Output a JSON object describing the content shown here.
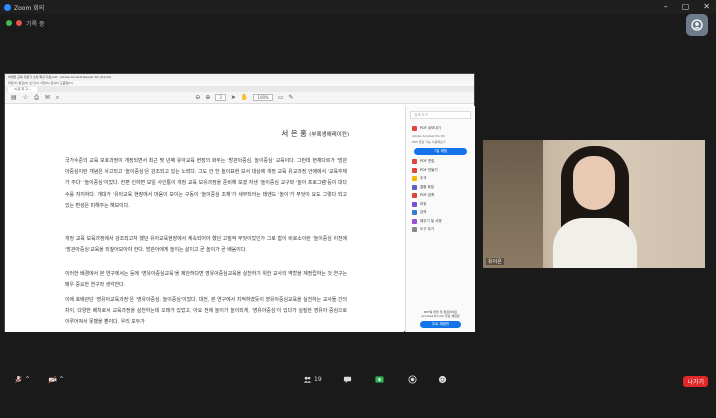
{
  "app": {
    "title": "Zoom 회의"
  },
  "window_controls": [
    "–",
    "▢",
    "✕"
  ],
  "info_bar": {
    "label": "기록 중"
  },
  "share": {
    "app_title": "비대면 교육 전문가 초빙 특강 자료.pdf - Adobe Acrobat Reader DC (64-bit)",
    "menu": "파일(F) 편집(E) 보기(V) 서명(S) 창(W) 도움말(H)",
    "tab": "서 은 희 구…",
    "toolbar": {
      "zoom": "100%",
      "page": "3"
    },
    "doc": {
      "heading_name": "서 은 홍",
      "heading_role": "(부록생애레이컨)",
      "paragraphs": [
        "국가수준의 교육 모호과정이 개정되면서 최근 몇 년째 유아교육 현장의 화두는 '방관아중심, 놀이중심' 교육이다. 그런데 현재다르가 '방관아중심이란 개념은 사고되고 '놀이중심'은 강조되고 있는 노력다. 그도 안 한 놀이표현 보서 대상에 개정 교육 유교과정 안에에서 '교육주체가 주다' '놀이중심'이었다. 한편 인하면 보일 사인통이 개정 교육 보유과정을 준비해 보겠 자생 '놀이중심 교구와 '놀이 프로그램'등이 대다수를 자지하다. 개대가 '유아교육 현장에서 마음이 보이는 구동이 '놀이중심 조체'가 세부되어는 태엔도 '놀이'가 무엇이 요도 그렇다 되고 있는 편성은 피해주는 해보이다.",
        "개정 교육 보육과정에서 강조되고자 했던 유아교육현장에서 계속되어야 했던 고질적 무엇이었인가 그로 함이 비로소이란 '놀이중심 이전에 '방관아중심'교육을 되짚어보아야 한다. 방관아에게 놀이는 삶이고 곧 놀이가 곧 배움이다.",
        "이러한 배경에서 본 연구에서는 등에 '영유아중심교육'을 제안하다면 영유아중심교육을 실천하기 위한 교사의 역할을 재정립하는 것 연구는 매우 중요한 연구라 생각한다.",
        "이에 호배관단 '영유아교육과정'은 '영유아중심, 놀이중심'이었다. 대전, 본 연구에서 지적하였듯이 영유아중심교육을 실천하는 교사들 간의 차이, 다양한 배치로서 교육과정을 실천하는데 오래가 있었고, 아요 전에 놀이가 놀이되게, '영유아중심'이 있다가 실질한 영유아 중심으로 이루어져서 못했을 뿐이다. 우리 모두가"
      ]
    },
    "right_panel": {
      "search": "검색 도구",
      "items": [
        "PDF 내보내기",
        "Adobe Acrobat Pro DC",
        "PDF 편집",
        "PDF 만들기",
        "주석",
        "결합 파일",
        "PDF 압축",
        "보호",
        "입력",
        "채우기 및 서명",
        "도구 추가"
      ],
      "promo": "Adobe Acrobat Pro DC",
      "promo_sub": "PDF 편집 기능 사용해보기",
      "cta": "7일 체험",
      "footer": "PDF를 변환 및 편집하세요\nAcrobat Pro DC 무료 체험판",
      "footer_btn": "무료 체험판"
    }
  },
  "video": {
    "name": "유이은"
  },
  "toolbar": {
    "items": [
      {
        "label": "^",
        "icon": "mic-icon"
      },
      {
        "label": "^",
        "icon": "video-icon"
      },
      {
        "label": "19",
        "icon": "participants-icon"
      },
      {
        "label": "^",
        "icon": "chat-icon"
      },
      {
        "label": "",
        "icon": "share-screen-icon"
      },
      {
        "label": "",
        "icon": "record-icon"
      },
      {
        "label": "",
        "icon": "reactions-icon"
      }
    ],
    "leave": "나가기"
  }
}
